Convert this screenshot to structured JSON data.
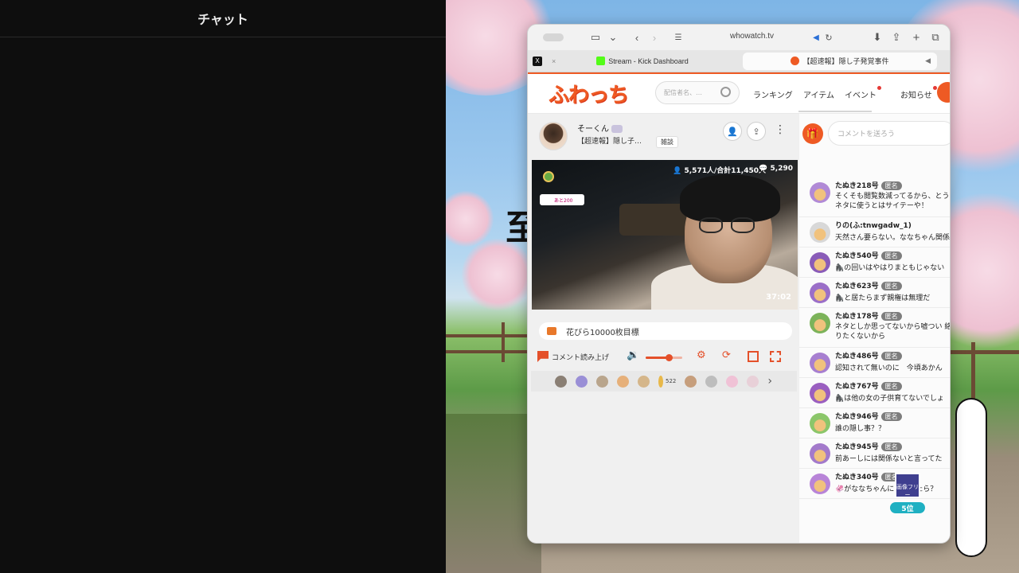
{
  "chat_panel": {
    "title": "チャット"
  },
  "background": {
    "vertical_text": "至"
  },
  "browser": {
    "url": "whowatch.tv",
    "tabs": [
      {
        "label": "Stream - Kick Dashboard"
      },
      {
        "label": "【超速報】隠し子発覚事件"
      }
    ]
  },
  "site": {
    "logo": "ふわっち",
    "search_placeholder": "配信者名、…",
    "nav": [
      "ランキング",
      "アイテム",
      "イベント",
      "お知らせ"
    ]
  },
  "stream": {
    "broadcaster_name": "そーくん",
    "title": "【超速報】隠し子…",
    "tag": "雑談",
    "viewers": "5,571人/合計11,450人",
    "comment_count": "5,290",
    "elapsed": "37:02",
    "goal_badge": "あと200",
    "goal_text": "花びら10000枚目標",
    "read_aloud_label": "コメント読み上げ",
    "volume_percent": 63,
    "gift_count": "522"
  },
  "comments": {
    "input_placeholder": "コメントを送ろう",
    "items": [
      {
        "name": "たぬき218号",
        "badge": "匿名",
        "text": "そくそも閲覧数減ってるから、とう をネタに使うとはサイテーや！",
        "tall": true
      },
      {
        "name": "りの(ふ:tnwgadw_1)",
        "badge": "",
        "text": "天然さん要らない。ななちゃん関係",
        "tall": false
      },
      {
        "name": "たぬき540号",
        "badge": "匿名",
        "text": "🦍の回いはやはりまともじゃない",
        "tall": false
      },
      {
        "name": "たぬき623号",
        "badge": "匿名",
        "text": "🦍と居たらまず親権は無理だ",
        "tall": false
      },
      {
        "name": "たぬき178号",
        "badge": "匿名",
        "text": "ネタとしか思ってないから嘘つい 絡取りたくないから",
        "tall": true
      },
      {
        "name": "たぬき486号",
        "badge": "匿名",
        "text": "認知されて無いのに　今頃あかん",
        "tall": false
      },
      {
        "name": "たぬき767号",
        "badge": "匿名",
        "text": "🦍は他の女の子供育てないでしょ",
        "tall": false
      },
      {
        "name": "たぬき946号",
        "badge": "匿名",
        "text": "誰の隠し事？？",
        "tall": false
      },
      {
        "name": "たぬき945号",
        "badge": "匿名",
        "text": "前あーしには関係ないと言ってた",
        "tall": false
      },
      {
        "name": "たぬき340号",
        "badge": "匿名",
        "text": "🦑がななちゃんに　　　たら？",
        "tall": false
      }
    ]
  },
  "ranking": {
    "card_text": "画像フリー",
    "rank": "5位"
  },
  "colors": {
    "brand": "#ee5a24",
    "rank_badge": "#1fb0c2",
    "anon_badge": "#7d7d7d"
  }
}
